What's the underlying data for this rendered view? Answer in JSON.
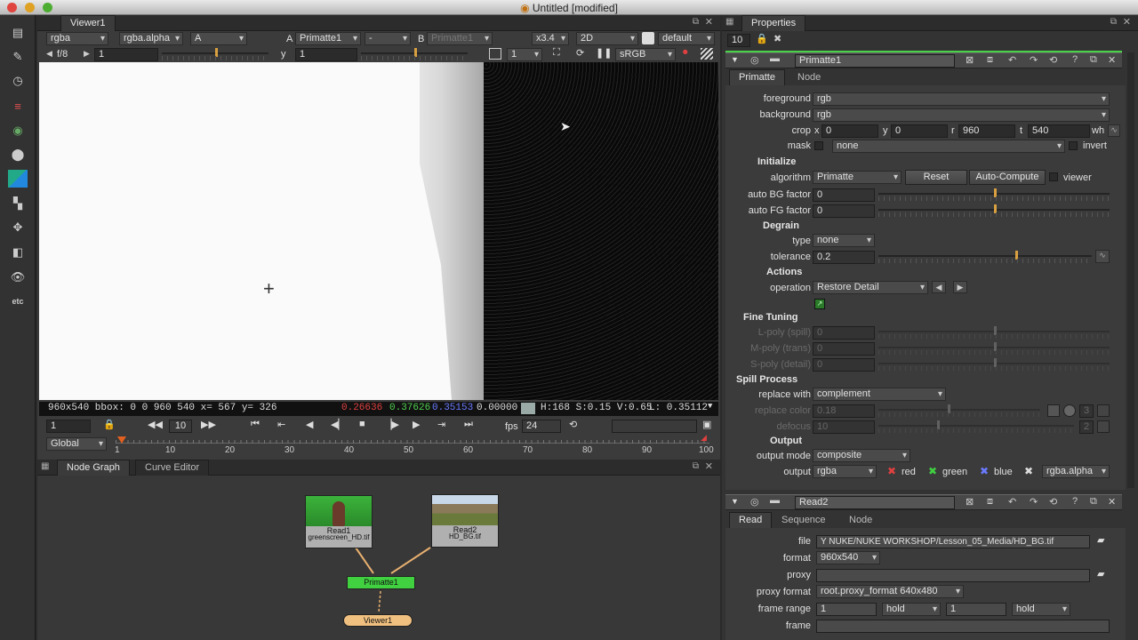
{
  "window": {
    "title": "Untitled [modified]"
  },
  "viewer": {
    "tab": "Viewer1",
    "channels": "rgba",
    "alpha": "rgba.alpha",
    "a_display": "A",
    "a_label": "A",
    "a_input": "Primatte1",
    "wipe": "-",
    "b_label": "B",
    "b_input": "Primatte1",
    "zoom": "x3.4",
    "view_mode": "2D",
    "lut_view": "default",
    "fstop": "f/8",
    "frame": "1",
    "y_label": "y",
    "y_value": "1",
    "proxy_scale": "1",
    "colorspace": "sRGB",
    "status_info": "960x540 bbox: 0 0 960 540  x= 567 y= 326",
    "r": "0.26636",
    "g": "0.37626",
    "b": "0.35153",
    "a": "0.00000",
    "hsv": "H:168 S:0.15 V:0.65",
    "luma": "L: 0.35112",
    "timeline": {
      "frame": "1",
      "inc": "10",
      "fps_label": "fps",
      "fps": "24",
      "scope": "Global",
      "ticks": [
        "1",
        "10",
        "20",
        "30",
        "40",
        "50",
        "60",
        "70",
        "80",
        "90",
        "100"
      ]
    }
  },
  "nodegraph": {
    "tabs": [
      "Node Graph",
      "Curve Editor"
    ],
    "read1": {
      "name": "Read1",
      "file": "greenscreen_HD.tif"
    },
    "read2": {
      "name": "Read2",
      "file": "HD_BG.tif"
    },
    "primatte": "Primatte1",
    "viewer": "Viewer1"
  },
  "properties": {
    "title": "Properties",
    "max_panels": "10",
    "primatte": {
      "name": "Primatte1",
      "tabs": [
        "Primatte",
        "Node"
      ],
      "foreground_label": "foreground",
      "foreground": "rgb",
      "background_label": "background",
      "background": "rgb",
      "crop_label": "crop",
      "crop_x_label": "x",
      "crop_x": "0",
      "crop_y_label": "y",
      "crop_y": "0",
      "crop_r_label": "r",
      "crop_r": "960",
      "crop_t_label": "t",
      "crop_t": "540",
      "crop_wh": "wh",
      "mask_label": "mask",
      "mask": "none",
      "invert": "invert",
      "initialize": "Initialize",
      "algorithm_label": "algorithm",
      "algorithm": "Primatte",
      "reset": "Reset",
      "auto_compute": "Auto-Compute",
      "viewer": "viewer",
      "auto_bg_label": "auto BG factor",
      "auto_bg": "0",
      "auto_fg_label": "auto FG factor",
      "auto_fg": "0",
      "degrain": "Degrain",
      "type_label": "type",
      "type": "none",
      "tolerance_label": "tolerance",
      "tolerance": "0.2",
      "actions": "Actions",
      "operation_label": "operation",
      "operation": "Restore Detail",
      "fine_tuning": "Fine Tuning",
      "lpoly_label": "L-poly (spill)",
      "lpoly": "0",
      "mpoly_label": "M-poly (trans)",
      "mpoly": "0",
      "spoly_label": "S-poly (detail)",
      "spoly": "0",
      "spill_process": "Spill Process",
      "replace_with_label": "replace with",
      "replace_with": "complement",
      "replace_color_label": "replace color",
      "replace_color": "0.18",
      "replace_color_num": "3",
      "defocus_label": "defocus",
      "defocus": "10",
      "defocus_num": "2",
      "output": "Output",
      "output_mode_label": "output mode",
      "output_mode": "composite",
      "output_label": "output",
      "output_value": "rgba",
      "red": "red",
      "green": "green",
      "blue": "blue",
      "alpha": "rgba.alpha"
    },
    "read2": {
      "name": "Read2",
      "tabs": [
        "Read",
        "Sequence",
        "Node"
      ],
      "file_label": "file",
      "file": "Y NUKE/NUKE WORKSHOP/Lesson_05_Media/HD_BG.tif",
      "format_label": "format",
      "format": "960x540",
      "proxy_label": "proxy",
      "proxy": "",
      "proxy_format_label": "proxy format",
      "proxy_format": "root.proxy_format 640x480",
      "frame_range_label": "frame range",
      "fr_start": "1",
      "fr_before": "hold",
      "fr_end": "1",
      "fr_after": "hold",
      "frame_label": "frame"
    }
  },
  "colors": {
    "accent": "#d8a040",
    "selected": "#4ad24a",
    "node_read": "#a8a8a8",
    "node_viewer": "#f0c080",
    "red": "#e04040",
    "green": "#40d040",
    "blue": "#5070ff"
  }
}
